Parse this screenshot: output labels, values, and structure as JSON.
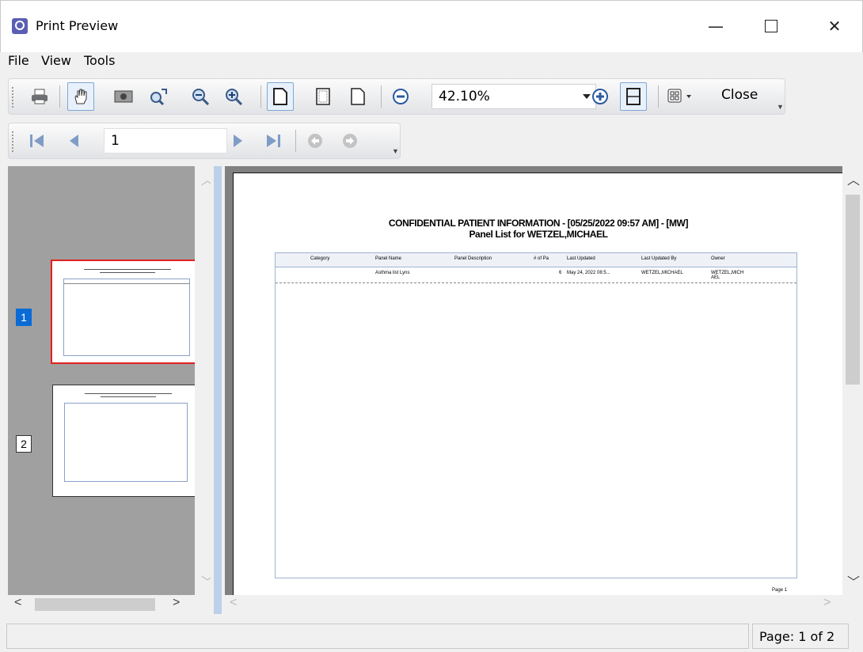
{
  "window": {
    "title": "Print Preview",
    "minimize_glyph": "—",
    "close_glyph": "✕"
  },
  "menu": {
    "items": [
      {
        "label": "File"
      },
      {
        "label": "View"
      },
      {
        "label": "Tools"
      }
    ]
  },
  "toolbar": {
    "zoom_value": "42.10%",
    "close_label": "Close",
    "current_page": "1"
  },
  "thumbnails": {
    "pages": [
      {
        "number": "1",
        "selected": true
      },
      {
        "number": "2",
        "selected": false
      }
    ]
  },
  "report": {
    "title_line1": "CONFIDENTIAL PATIENT INFORMATION - [05/25/2022 09:57 AM] - [MW]",
    "title_line2": "Panel List for WETZEL,MICHAEL",
    "columns": [
      "Category",
      "Panel Name",
      "Panel Description",
      "# of Pa",
      "Last Updated",
      "Last Updated By",
      "Owner"
    ],
    "row": {
      "panel_name": "Asthma list Lyns",
      "count": "6",
      "last_updated": "May 24, 2022 08:5...",
      "last_updated_by": "WETZEL,MICHAEL",
      "owner": "WETZEL,MICH AEL"
    },
    "footer": "Page 1"
  },
  "status": {
    "page_label": "Page: 1 of 2"
  }
}
